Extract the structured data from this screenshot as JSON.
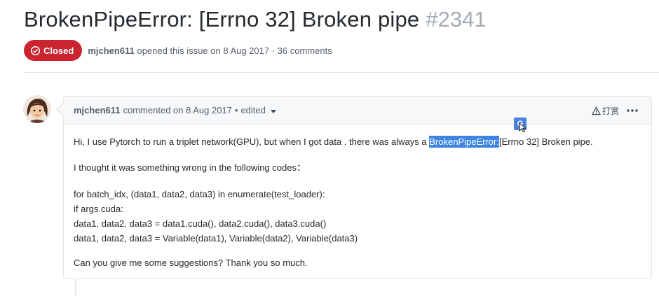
{
  "issue": {
    "title": "BrokenPipeError: [Errno 32] Broken pipe",
    "number": "#2341",
    "state": "Closed",
    "author": "mjchen611",
    "meta_text": "opened this issue on 8 Aug 2017 · 36 comments"
  },
  "comment": {
    "author": "mjchen611",
    "action": "commented on 8 Aug 2017",
    "dot": "•",
    "edited": "edited",
    "report_label": "打赏",
    "body": {
      "p1_before": "Hi, I use Pytorch to run a triplet network(GPU), but when I got data . there was always a ",
      "p1_highlight": "BrokenPipeError:",
      "p1_after": "[Errno 32] Broken pipe.",
      "p2": "I thought it was something wrong in the following codes：",
      "code_lines": [
        "for batch_idx, (data1, data2, data3) in enumerate(test_loader):",
        "if args.cuda:",
        "data1, data2, data3 = data1.cuda(), data2.cuda(), data3.cuda()",
        "data1, data2, data3 = Variable(data1), Variable(data2), Variable(data3)"
      ],
      "p3": "Can you give me some suggestions? Thank you so much."
    }
  },
  "translate_button": {
    "glyph": "G"
  },
  "colors": {
    "closed_red": "#cb2431",
    "selection_blue": "#3d85e0",
    "muted_text": "#586069",
    "border": "#e1e4e8"
  },
  "icons": [
    "issue-closed-icon",
    "report-icon",
    "more-icon",
    "translate-icon",
    "cursor-icon",
    "avatar"
  ]
}
